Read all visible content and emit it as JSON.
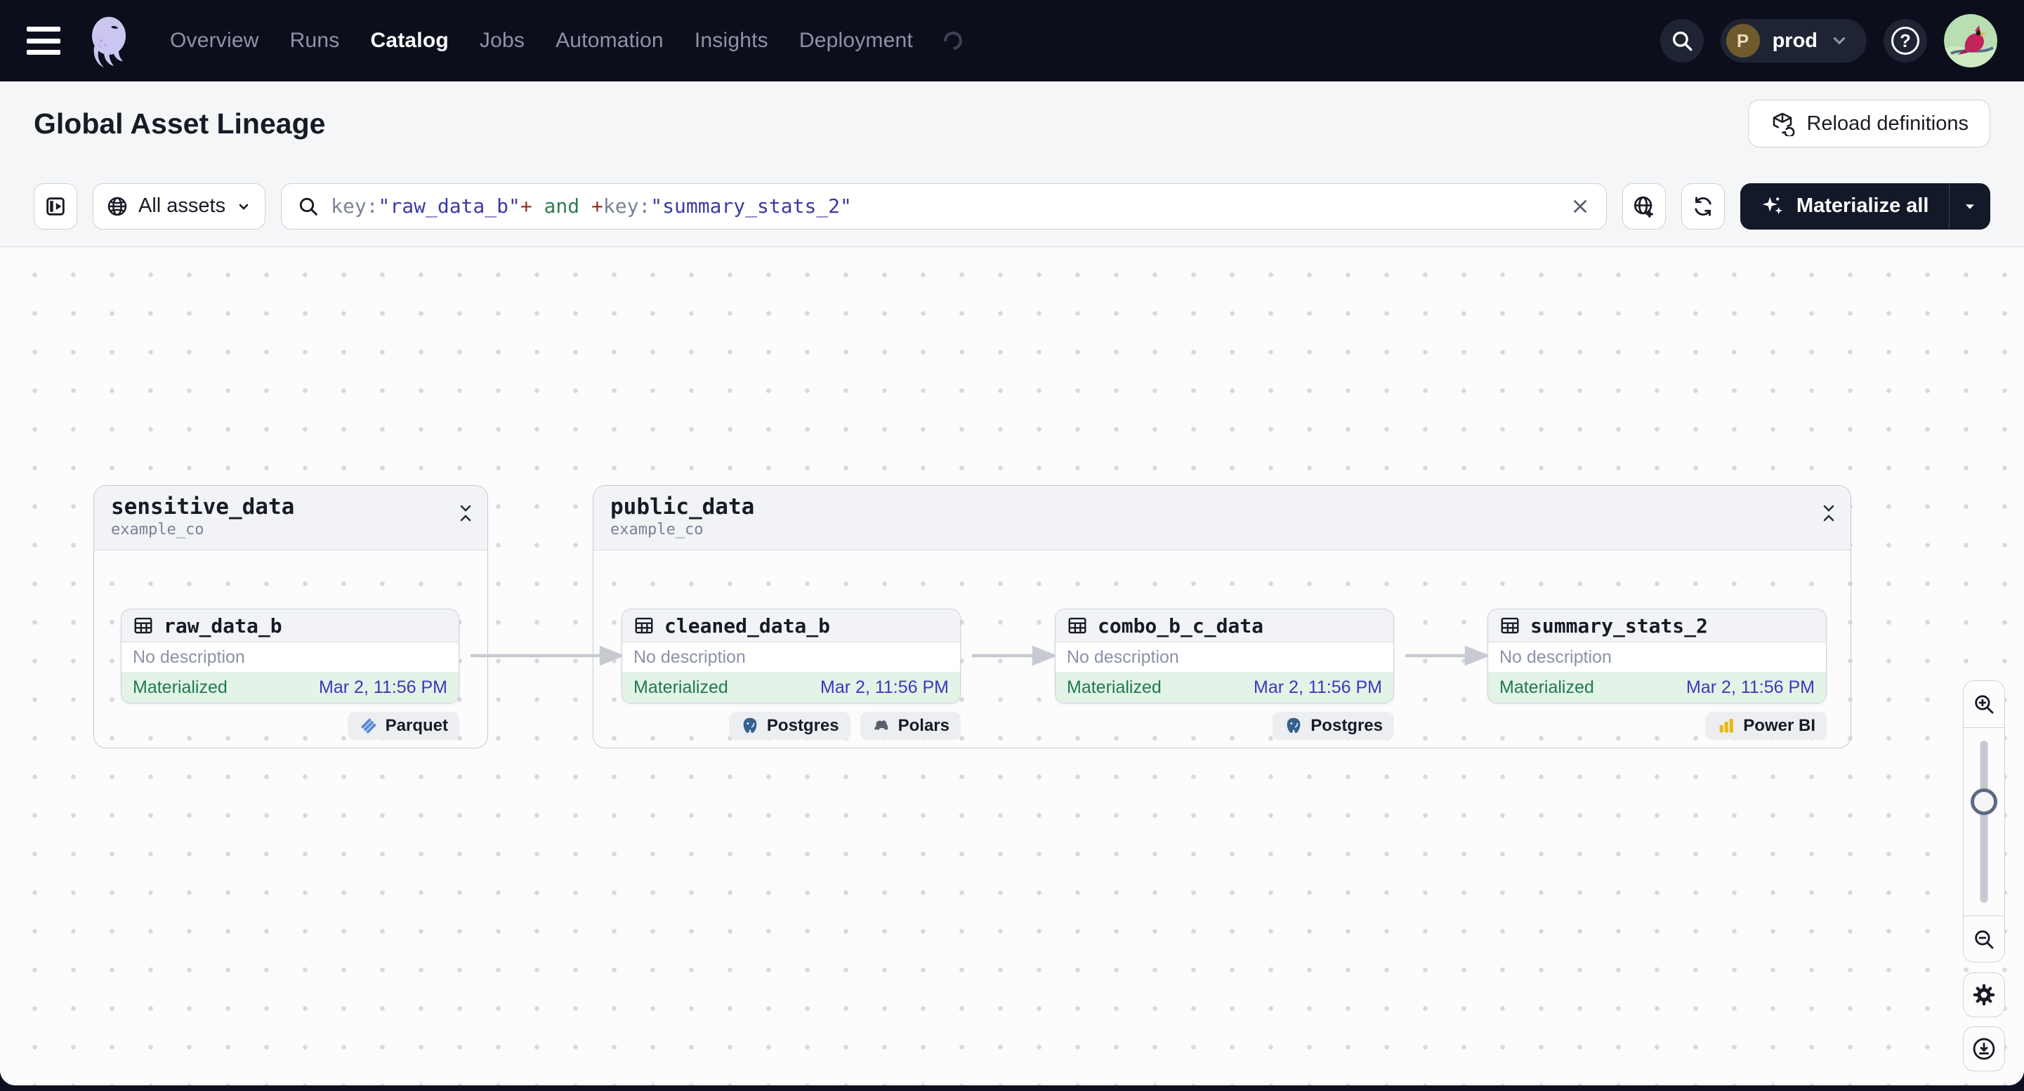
{
  "nav": {
    "items": [
      {
        "label": "Overview"
      },
      {
        "label": "Runs"
      },
      {
        "label": "Catalog"
      },
      {
        "label": "Jobs"
      },
      {
        "label": "Automation"
      },
      {
        "label": "Insights"
      },
      {
        "label": "Deployment"
      }
    ],
    "active_item": "Catalog",
    "environment": {
      "initial": "P",
      "name": "prod"
    }
  },
  "header": {
    "title": "Global Asset Lineage",
    "reload_button_label": "Reload definitions"
  },
  "toolbar": {
    "scope_label": "All assets",
    "query": {
      "tokens": [
        {
          "text": "key:",
          "type": "key",
          "color": "#7b8494"
        },
        {
          "text": "\"raw_data_b\"",
          "type": "string",
          "color": "#3b3aa6"
        },
        {
          "text": "+",
          "type": "operator",
          "color": "#8f3022"
        },
        {
          "text": " and ",
          "type": "keyword",
          "color": "#2f7d4f"
        },
        {
          "text": "+",
          "type": "operator",
          "color": "#8f3022"
        },
        {
          "text": "key:",
          "type": "key",
          "color": "#7b8494"
        },
        {
          "text": "\"summary_stats_2\"",
          "type": "string",
          "color": "#3b3aa6"
        }
      ]
    },
    "materialize_label": "Materialize all"
  },
  "graph": {
    "groups": [
      {
        "title": "sensitive_data",
        "subtitle": "example_co"
      },
      {
        "title": "public_data",
        "subtitle": "example_co"
      }
    ],
    "assets": [
      {
        "name": "raw_data_b",
        "description": "No description",
        "status": "Materialized",
        "timestamp": "Mar 2, 11:56 PM",
        "tags": [
          {
            "label": "Parquet",
            "icon": "parquet-icon"
          }
        ]
      },
      {
        "name": "cleaned_data_b",
        "description": "No description",
        "status": "Materialized",
        "timestamp": "Mar 2, 11:56 PM",
        "tags": [
          {
            "label": "Postgres",
            "icon": "postgres-icon"
          },
          {
            "label": "Polars",
            "icon": "polars-icon"
          }
        ]
      },
      {
        "name": "combo_b_c_data",
        "description": "No description",
        "status": "Materialized",
        "timestamp": "Mar 2, 11:56 PM",
        "tags": [
          {
            "label": "Postgres",
            "icon": "postgres-icon"
          }
        ]
      },
      {
        "name": "summary_stats_2",
        "description": "No description",
        "status": "Materialized",
        "timestamp": "Mar 2, 11:56 PM",
        "tags": [
          {
            "label": "Power BI",
            "icon": "powerbi-icon"
          }
        ]
      }
    ],
    "edges": [
      {
        "from": "raw_data_b",
        "to": "cleaned_data_b"
      },
      {
        "from": "cleaned_data_b",
        "to": "combo_b_c_data"
      },
      {
        "from": "combo_b_c_data",
        "to": "summary_stats_2"
      }
    ]
  },
  "icons": {
    "hamburger": "menu-icon",
    "logo": "dagster-octopus-logo",
    "search": "magnifier",
    "help": "question-circle",
    "reload": "cube-refresh",
    "scope": "globe",
    "new_tab_filter": "globe-plus",
    "refresh": "rotate-arrows",
    "materialize": "sparkles",
    "asset": "table-grid",
    "collapse": "collapse-chevrons",
    "zoom_in": "magnifier-plus",
    "zoom_out": "magnifier-minus",
    "settings": "gear",
    "download": "circle-download"
  },
  "colors": {
    "nav_bg": "#0c0e1c",
    "bar_bg": "#f5f6f8",
    "canvas_bg": "#fcfcfd",
    "materialized_bg": "#e3f3e8",
    "materialized_text": "#207a4b",
    "timestamp_text": "#3c39b8",
    "materialize_btn_bg": "#141929",
    "env_avatar_bg": "#6e5a2a",
    "edge": "#c7cad1"
  }
}
